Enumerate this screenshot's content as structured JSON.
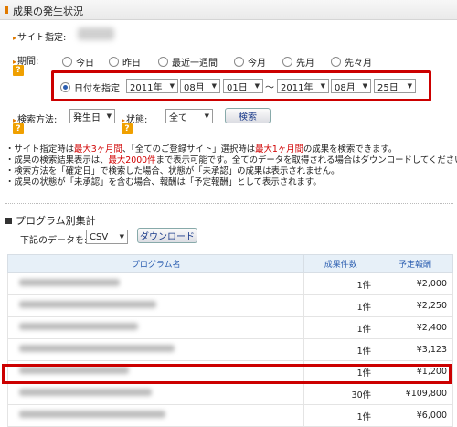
{
  "section_title": "成果の発生状況",
  "site_label": "サイト指定:",
  "period_label": "期間:",
  "period_options": [
    "今日",
    "昨日",
    "最近一週間",
    "今月",
    "先月",
    "先々月"
  ],
  "date_range": {
    "label": "日付を指定",
    "from": {
      "year": "2011年",
      "month": "08月",
      "day": "01日"
    },
    "sep": "〜",
    "to": {
      "year": "2011年",
      "month": "08月",
      "day": "25日"
    }
  },
  "search_method": {
    "label": "検索方法:",
    "value": "発生日"
  },
  "status": {
    "label": "状態:",
    "value": "全て"
  },
  "search_button": "検索",
  "help_mark": "?",
  "notes": [
    [
      {
        "t": "・サイト指定時は"
      },
      {
        "t": "最大3ヶ月間",
        "red": true
      },
      {
        "t": "、「全てのご登録サイト」選択時は"
      },
      {
        "t": "最大1ヶ月間",
        "red": true
      },
      {
        "t": "の成果を検索できます。"
      }
    ],
    [
      {
        "t": "・成果の検索結果表示は、"
      },
      {
        "t": "最大2000件",
        "red": true
      },
      {
        "t": "まで表示可能です。全てのデータを取得される場合はダウンロードしてください。"
      }
    ],
    [
      {
        "t": "・検索方法を「確定日」で検索した場合、状態が「未承認」の成果は表示されません。"
      }
    ],
    [
      {
        "t": "・成果の状態が「未承認」を含む場合、報酬は「予定報酬」として表示されます。"
      }
    ]
  ],
  "program_section": {
    "title": "プログラム別集計",
    "data_label": "下記のデータを:",
    "format": "CSV",
    "download_button": "ダウンロード"
  },
  "table": {
    "headers": [
      "プログラム名",
      "成果件数",
      "予定報酬"
    ],
    "rows": [
      {
        "count": "1件",
        "reward": "¥2,000"
      },
      {
        "count": "1件",
        "reward": "¥2,250"
      },
      {
        "count": "1件",
        "reward": "¥2,400"
      },
      {
        "count": "1件",
        "reward": "¥3,123"
      },
      {
        "count": "1件",
        "reward": "¥1,200"
      },
      {
        "count": "30件",
        "reward": "¥109,800"
      },
      {
        "count": "1件",
        "reward": "¥6,000"
      }
    ]
  },
  "colors": {
    "accent_red": "#cc0000",
    "header_blue": "#2a5db0",
    "help_orange": "#f0a000"
  }
}
